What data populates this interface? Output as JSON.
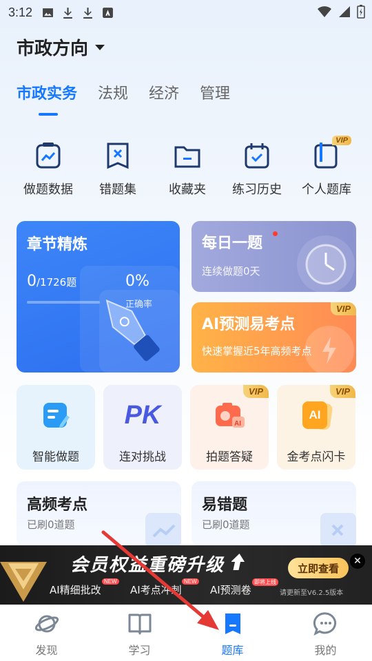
{
  "status_bar": {
    "time": "3:12"
  },
  "header": {
    "title": "市政方向"
  },
  "tabs": [
    {
      "label": "市政实务",
      "active": true
    },
    {
      "label": "法规",
      "active": false
    },
    {
      "label": "经济",
      "active": false
    },
    {
      "label": "管理",
      "active": false
    }
  ],
  "quick_actions": [
    {
      "label": "做题数据",
      "icon": "chart-icon"
    },
    {
      "label": "错题集",
      "icon": "wrong-book-icon"
    },
    {
      "label": "收藏夹",
      "icon": "folder-icon"
    },
    {
      "label": "练习历史",
      "icon": "calendar-check-icon"
    },
    {
      "label": "个人题库",
      "icon": "personal-bank-icon",
      "badge": "VIP"
    }
  ],
  "chapter_card": {
    "title": "章节精炼",
    "done": "0",
    "total": "/1726题",
    "progress_fraction": 0,
    "accuracy": "0%",
    "accuracy_label": "正确率"
  },
  "daily_card": {
    "title": "每日一题",
    "subtitle": "连续做题0天"
  },
  "ai_predict_card": {
    "title": "AI预测易考点",
    "subtitle": "快速掌握近5年高频考点",
    "badge": "VIP"
  },
  "tiles": [
    {
      "label": "智能做题",
      "icon": "smart-practice-icon"
    },
    {
      "label": "连对挑战",
      "icon": "pk-icon",
      "icon_text": "PK"
    },
    {
      "label": "拍题答疑",
      "icon": "camera-ai-icon",
      "badge": "VIP"
    },
    {
      "label": "金考点闪卡",
      "icon": "ai-flashcard-icon",
      "badge": "VIP",
      "icon_text": "AI"
    }
  ],
  "wide_cards": [
    {
      "title": "高频考点",
      "subtitle": "已刷0道题"
    },
    {
      "title": "易错题",
      "subtitle": "已刷0道题"
    }
  ],
  "banner": {
    "headline": "会员权益重磅升级",
    "features": [
      "AI精细批改",
      "AI考点冲刺",
      "AI预测卷"
    ],
    "new_tag": "NEW",
    "launch_tag": "即将上线",
    "cta": "立即查看",
    "version_note": "请更新至V6.2.5版本"
  },
  "bottom_nav": [
    {
      "label": "发现",
      "icon": "planet-icon",
      "active": false
    },
    {
      "label": "学习",
      "icon": "book-icon",
      "active": false
    },
    {
      "label": "题库",
      "icon": "question-bank-icon",
      "active": true
    },
    {
      "label": "我的",
      "icon": "chat-bubble-icon",
      "active": false
    }
  ],
  "colors": {
    "accent": "#1677ff",
    "chapter_card": "#3d86f8",
    "daily_card": "#9aa2da",
    "ai_card": "#ff9a50",
    "vip_gold": "#f0b84a",
    "annotation_arrow": "#e53935"
  }
}
